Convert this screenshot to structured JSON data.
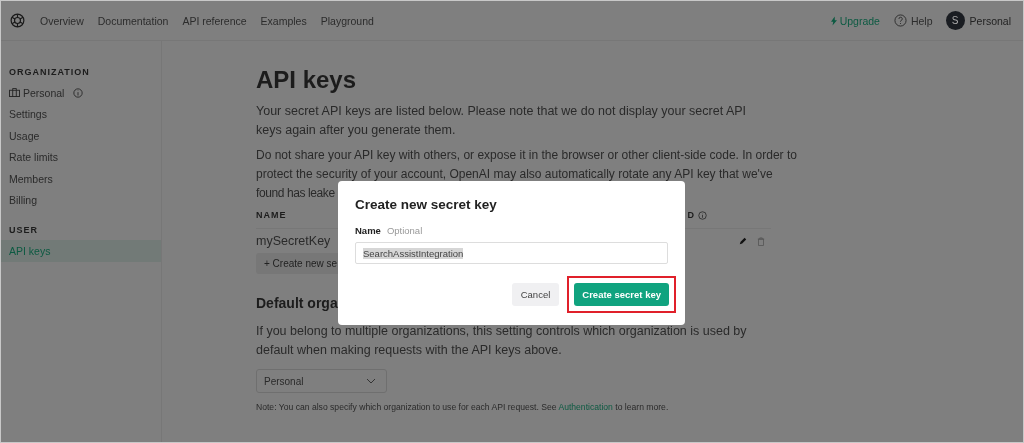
{
  "nav": {
    "links": [
      {
        "label": "Overview",
        "selected": false
      },
      {
        "label": "Documentation",
        "selected": false
      },
      {
        "label": "API reference",
        "selected": false
      },
      {
        "label": "Examples",
        "selected": false
      },
      {
        "label": "Playground",
        "selected": false
      }
    ],
    "upgrade": "Upgrade",
    "help": "Help",
    "avatar_initial": "S",
    "account": "Personal"
  },
  "sidebar": {
    "sections": [
      {
        "heading": "ORGANIZATION",
        "items": [
          {
            "label": "Personal",
            "kind": "org",
            "selected": false
          },
          {
            "label": "Settings",
            "kind": "link",
            "selected": false
          },
          {
            "label": "Usage",
            "kind": "link",
            "selected": false
          },
          {
            "label": "Rate limits",
            "kind": "link",
            "selected": false
          },
          {
            "label": "Members",
            "kind": "link",
            "selected": false
          },
          {
            "label": "Billing",
            "kind": "link",
            "selected": false
          }
        ]
      },
      {
        "heading": "USER",
        "items": [
          {
            "label": "API keys",
            "kind": "link",
            "selected": true
          }
        ]
      }
    ]
  },
  "main": {
    "title": "API keys",
    "paragraph_1": "Your secret API keys are listed below. Please note that we do not display your secret API keys again after you generate them.",
    "paragraph_2_lines": [
      "Do not share your API key with others, or expose it in the browser or other client-side code. In order to",
      "protect the security of your account, OpenAI may also automatically rotate any API key that we've",
      "found has leake"
    ],
    "table": {
      "columns": [
        "NAME",
        "D"
      ],
      "rows": [
        {
          "name": "mySecretKey"
        }
      ]
    },
    "create_button": "+ Create new se",
    "default_org_heading": "Default orga",
    "default_org_text": "If you belong to multiple organizations, this setting controls which organization is used by default when making requests with the API keys above.",
    "org_select": "Personal",
    "note": "Note: You can also specify which organization to use for each API request. See ",
    "note_link": "Authentication",
    "note_end": " to learn more."
  },
  "dialog": {
    "title": "Create new secret key",
    "field_label": "Name",
    "field_hint": "Optional",
    "field_value": "SearchAssistIntegration",
    "cancel": "Cancel",
    "submit": "Create secret key"
  }
}
